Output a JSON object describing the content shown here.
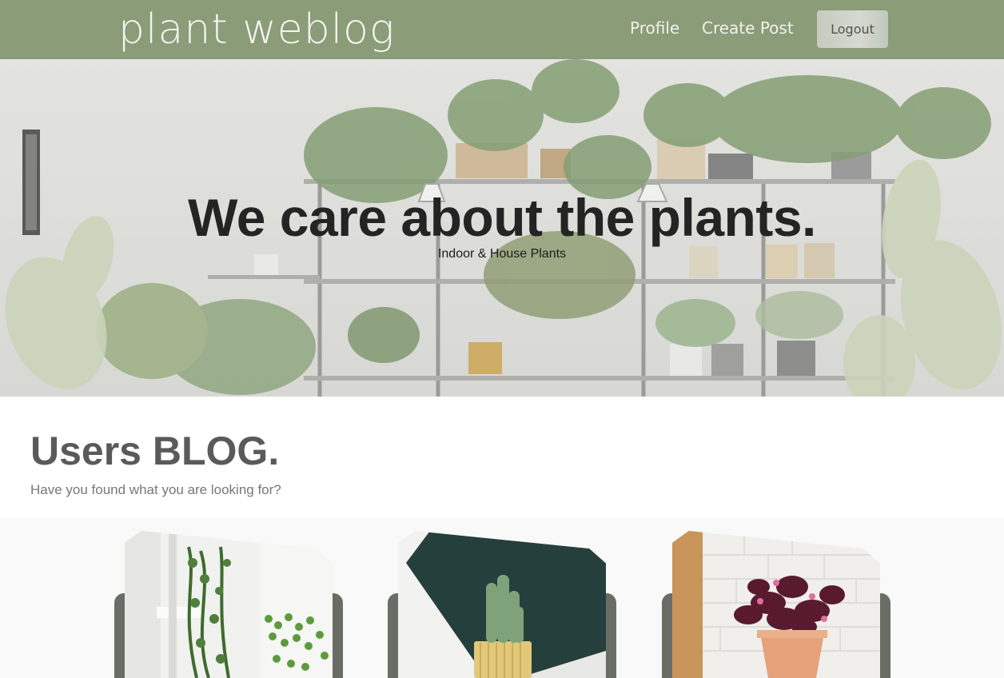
{
  "nav": {
    "brand": "plant weblog",
    "links": [
      "Profile",
      "Create Post"
    ],
    "logout_label": "Logout"
  },
  "hero": {
    "title": "We care about the plants.",
    "subtitle": "Indoor & House Plants"
  },
  "blog": {
    "title": "Users BLOG.",
    "subtitle": "Have you found what you are looking for?"
  },
  "cards": [
    {
      "image": "hanging-plants-photo"
    },
    {
      "image": "cactus-photo"
    },
    {
      "image": "purple-oxalis-photo"
    }
  ],
  "colors": {
    "navbar": "#8a9c78",
    "brand_text": "#f4f4ee",
    "card_back": "#6a6d66"
  }
}
